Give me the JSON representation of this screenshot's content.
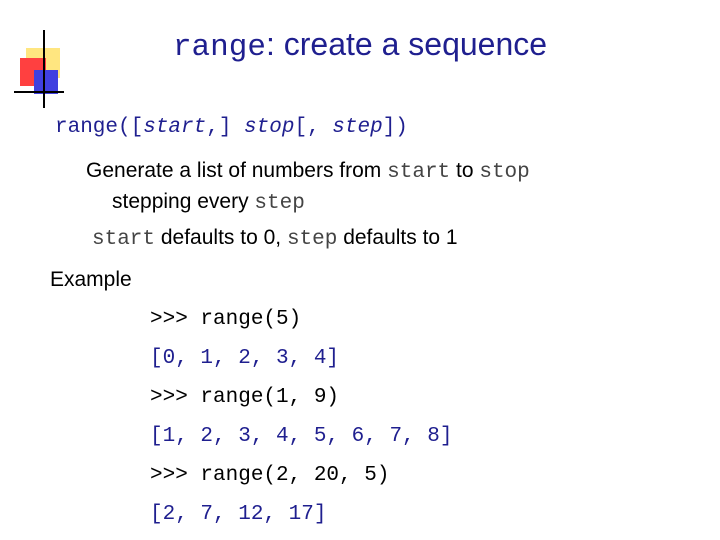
{
  "title": {
    "code": "range",
    "rest": ": create a sequence"
  },
  "signature": {
    "p1": "range([",
    "start": "start",
    "p2": ",] ",
    "stop": "stop",
    "p3": "[, ",
    "step": "step",
    "p4": "])"
  },
  "description": {
    "t1": "Generate a list of numbers from ",
    "start": "start",
    "t2": " to ",
    "stop": "stop",
    "t3": "stepping every ",
    "step": "step"
  },
  "defaults": {
    "start": "start",
    "t1": " defaults to 0, ",
    "step": "step",
    "t2": " defaults to 1"
  },
  "example_label": "Example",
  "examples": [
    ">>> range(5)",
    "[0, 1, 2, 3, 4]",
    ">>> range(1, 9)",
    "[1, 2, 3, 4, 5, 6, 7, 8]",
    ">>> range(2, 20, 5)",
    "[2, 7, 12, 17]"
  ],
  "colors": {
    "title": "#1f1f8f",
    "code_inline": "#444444",
    "result": "#1f1f8f"
  }
}
